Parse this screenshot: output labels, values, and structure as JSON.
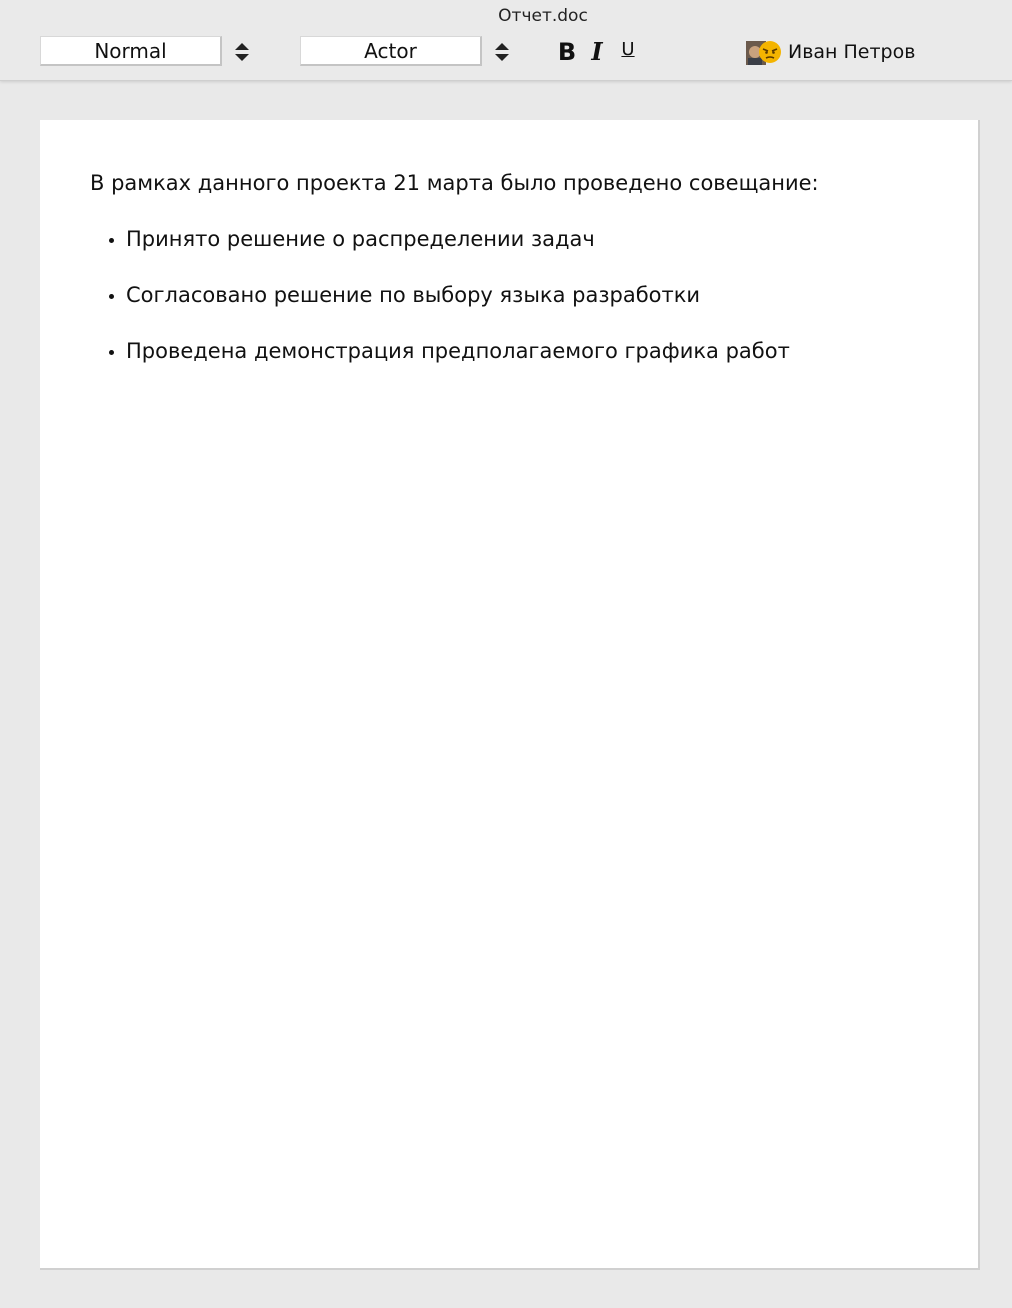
{
  "window": {
    "title": "Отчет.doc"
  },
  "toolbar": {
    "style_select": {
      "value": "Normal"
    },
    "font_select": {
      "value": "Actor"
    },
    "bold_label": "B",
    "italic_label": "I",
    "underline_label": "U",
    "user_name": "Иван Петров"
  },
  "document": {
    "paragraph": "В рамках данного проекта 21 марта было проведено совещание:",
    "bullets": [
      "Принято решение о распределении задач",
      "Согласовано решение по выбору языка разработки",
      "Проведена демонстрация предполагаемого графика работ"
    ]
  },
  "icons": {
    "stepper": "up-down-arrows-icon",
    "avatar": "user-avatar-icon"
  }
}
